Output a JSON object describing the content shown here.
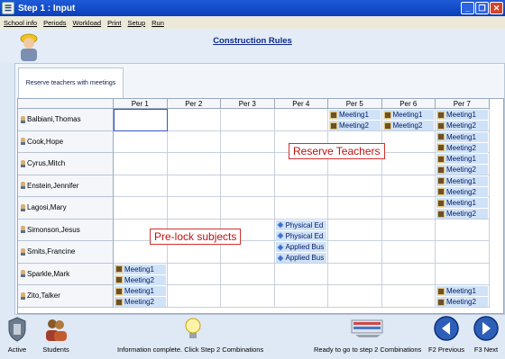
{
  "window": {
    "title": "Step 1 : Input",
    "min": "_",
    "restore": "❐",
    "close": "✕",
    "icon": "☰"
  },
  "menu": [
    "School info",
    "Periods",
    "Workload",
    "Print",
    "Setup",
    "Run"
  ],
  "header": {
    "title": "Construction Rules"
  },
  "tab": {
    "label": "Reserve teachers with meetings"
  },
  "periods": [
    "Per 1",
    "Per 2",
    "Per 3",
    "Per 4",
    "Per 5",
    "Per 6",
    "Per 7"
  ],
  "teachers": [
    "Balbiani,Thomas",
    "Cook,Hope",
    "Cyrus,Mitch",
    "Enstein,Jennifer",
    "Lagosi,Mary",
    "Simonson,Jesus",
    "Smits,Francine",
    "Sparkle,Mark",
    "Zito,Talker"
  ],
  "labels": {
    "meeting1": "Meeting1",
    "meeting2": "Meeting2",
    "phys": "Physical Ed",
    "applied": "Applied Bus"
  },
  "overlays": {
    "reserve": "Reserve Teachers",
    "prelock": "Pre-lock subjects"
  },
  "bottom": {
    "active": "Active",
    "students": "Students",
    "info": "Information complete. Click Step 2 Combinations",
    "ready": "Ready to go to step 2 Combinations",
    "prev": "F2 Previous",
    "next": "F3 Next"
  }
}
